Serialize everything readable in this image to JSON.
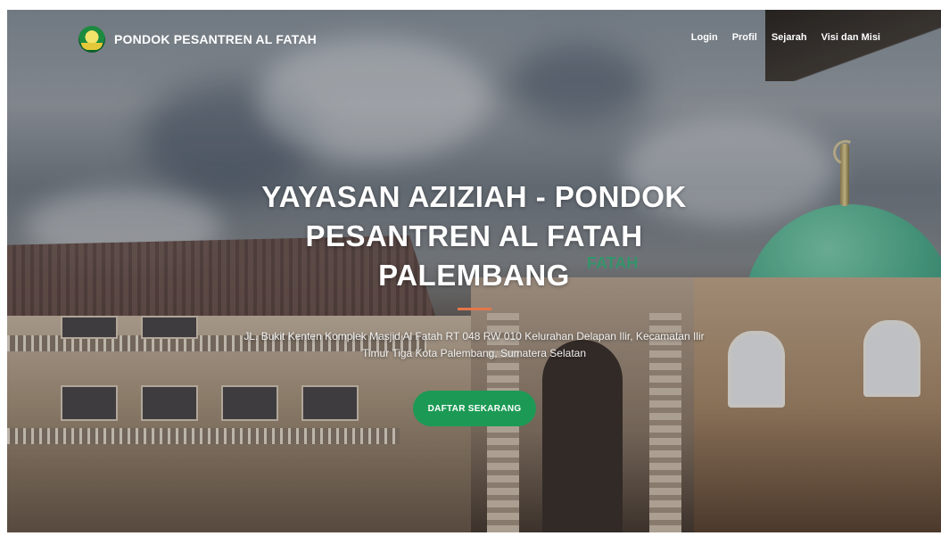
{
  "navbar": {
    "brand": "PONDOK PESANTREN AL FATAH",
    "logo_icon": "school-crest-logo",
    "menu": [
      {
        "label": "Login"
      },
      {
        "label": "Profil"
      },
      {
        "label": "Sejarah"
      },
      {
        "label": "Visi dan Misi"
      }
    ]
  },
  "hero": {
    "title_lines": [
      "YAYASAN AZIZIAH - PONDOK",
      "PESANTREN AL FATAH",
      "PALEMBANG"
    ],
    "address_lines": [
      "JL. Bukit Kenten Komplek Masjid Al Fatah RT 048 RW 010 Kelurahan Delapan Ilir, Kecamatan Ilir",
      "Timur Tiga Kota Palembang, Sumatera Selatan"
    ],
    "cta_label": "DAFTAR SEKARANG",
    "sign_text": "FATAH"
  },
  "colors": {
    "cta": "#1c9a55",
    "divider": "#e5764a",
    "text": "#ffffff"
  }
}
